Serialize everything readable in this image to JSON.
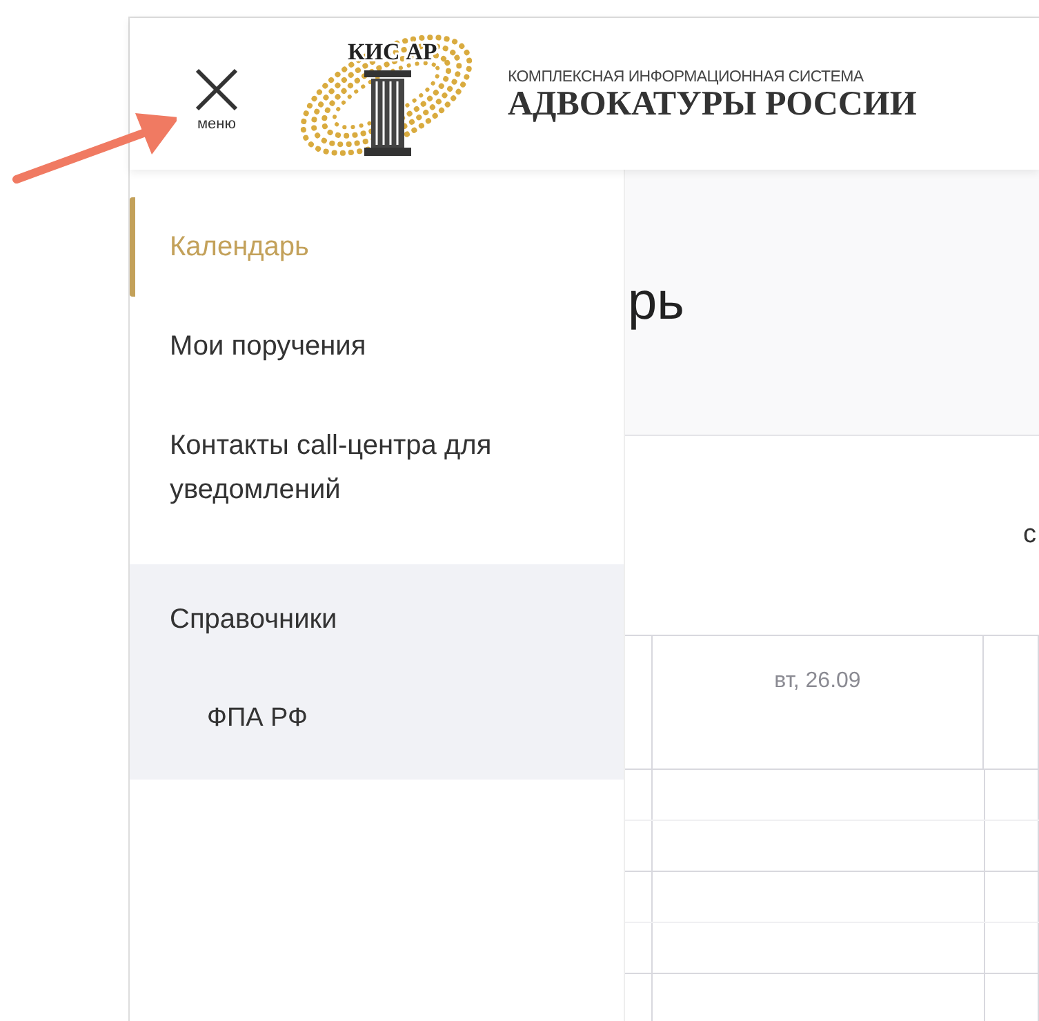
{
  "header": {
    "menu_button": {
      "label": "меню",
      "open": true
    },
    "logo": {
      "text": "КИС АР"
    },
    "subtitle": "КОМПЛЕКСНАЯ ИНФОРМАЦИОННАЯ СИСТЕМА",
    "title": "АДВОКАТУРЫ РОССИИ"
  },
  "sidebar": {
    "items": [
      {
        "label": "Календарь",
        "selected": true
      },
      {
        "label": "Мои поручения",
        "selected": false
      },
      {
        "label": "Контакты call-центра для уведомлений",
        "selected": false
      },
      {
        "label": "Справочники",
        "selected": false,
        "expanded": true,
        "children": [
          {
            "label": "ФПА РФ",
            "selected": false
          }
        ]
      }
    ]
  },
  "main": {
    "title": "рь",
    "toolbar_text": "с",
    "table": {
      "columns": [
        "вт, 26.09"
      ]
    }
  }
}
